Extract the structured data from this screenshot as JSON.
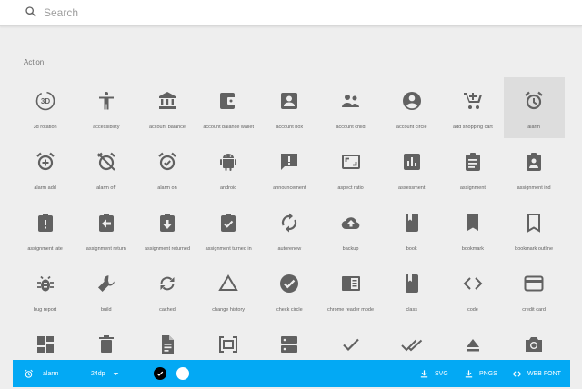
{
  "search": {
    "placeholder": "Search"
  },
  "section": {
    "title": "Action"
  },
  "icons": [
    {
      "label": "3d rotation",
      "icon": "3d-rotation-icon"
    },
    {
      "label": "accessibility",
      "icon": "accessibility-icon"
    },
    {
      "label": "account balance",
      "icon": "account-balance-icon"
    },
    {
      "label": "account balance wallet",
      "icon": "account-balance-wallet-icon"
    },
    {
      "label": "account box",
      "icon": "account-box-icon"
    },
    {
      "label": "account child",
      "icon": "account-child-icon"
    },
    {
      "label": "account circle",
      "icon": "account-circle-icon"
    },
    {
      "label": "add shopping cart",
      "icon": "add-shopping-cart-icon"
    },
    {
      "label": "alarm",
      "icon": "alarm-icon",
      "selected": true
    },
    {
      "label": "alarm add",
      "icon": "alarm-add-icon"
    },
    {
      "label": "alarm off",
      "icon": "alarm-off-icon"
    },
    {
      "label": "alarm on",
      "icon": "alarm-on-icon"
    },
    {
      "label": "android",
      "icon": "android-icon"
    },
    {
      "label": "announcement",
      "icon": "announcement-icon"
    },
    {
      "label": "aspect ratio",
      "icon": "aspect-ratio-icon"
    },
    {
      "label": "assessment",
      "icon": "assessment-icon"
    },
    {
      "label": "assignment",
      "icon": "assignment-icon"
    },
    {
      "label": "assignment ind",
      "icon": "assignment-ind-icon"
    },
    {
      "label": "assignment late",
      "icon": "assignment-late-icon"
    },
    {
      "label": "assignment return",
      "icon": "assignment-return-icon"
    },
    {
      "label": "assignment returned",
      "icon": "assignment-returned-icon"
    },
    {
      "label": "assignment turned in",
      "icon": "assignment-turned-in-icon"
    },
    {
      "label": "autorenew",
      "icon": "autorenew-icon"
    },
    {
      "label": "backup",
      "icon": "backup-icon"
    },
    {
      "label": "book",
      "icon": "book-icon"
    },
    {
      "label": "bookmark",
      "icon": "bookmark-icon"
    },
    {
      "label": "bookmark outline",
      "icon": "bookmark-outline-icon"
    },
    {
      "label": "bug report",
      "icon": "bug-report-icon"
    },
    {
      "label": "build",
      "icon": "build-icon"
    },
    {
      "label": "cached",
      "icon": "cached-icon"
    },
    {
      "label": "change history",
      "icon": "change-history-icon"
    },
    {
      "label": "check circle",
      "icon": "check-circle-icon"
    },
    {
      "label": "chrome reader mode",
      "icon": "chrome-reader-mode-icon"
    },
    {
      "label": "class",
      "icon": "class-icon"
    },
    {
      "label": "code",
      "icon": "code-icon"
    },
    {
      "label": "credit card",
      "icon": "credit-card-icon"
    },
    {
      "label": "",
      "icon": "dashboard-icon"
    },
    {
      "label": "",
      "icon": "delete-icon"
    },
    {
      "label": "",
      "icon": "description-icon"
    },
    {
      "label": "",
      "icon": "dns-icon"
    },
    {
      "label": "",
      "icon": "dns-list-icon"
    },
    {
      "label": "",
      "icon": "done-icon"
    },
    {
      "label": "",
      "icon": "done-all-icon"
    },
    {
      "label": "",
      "icon": "eject-icon"
    },
    {
      "label": "",
      "icon": "photo-camera-icon"
    }
  ],
  "bottom_bar": {
    "selected_name": "alarm",
    "size": "24dp",
    "svg_label": "SVG",
    "pngs_label": "PNGS",
    "webfont_label": "WEB FONT",
    "color": "#03a9f4",
    "swatches": [
      "#000000",
      "#ffffff"
    ]
  },
  "colors": {
    "icon": "#616161",
    "selected_tile": "#dddddd",
    "background": "#eeeeee"
  }
}
